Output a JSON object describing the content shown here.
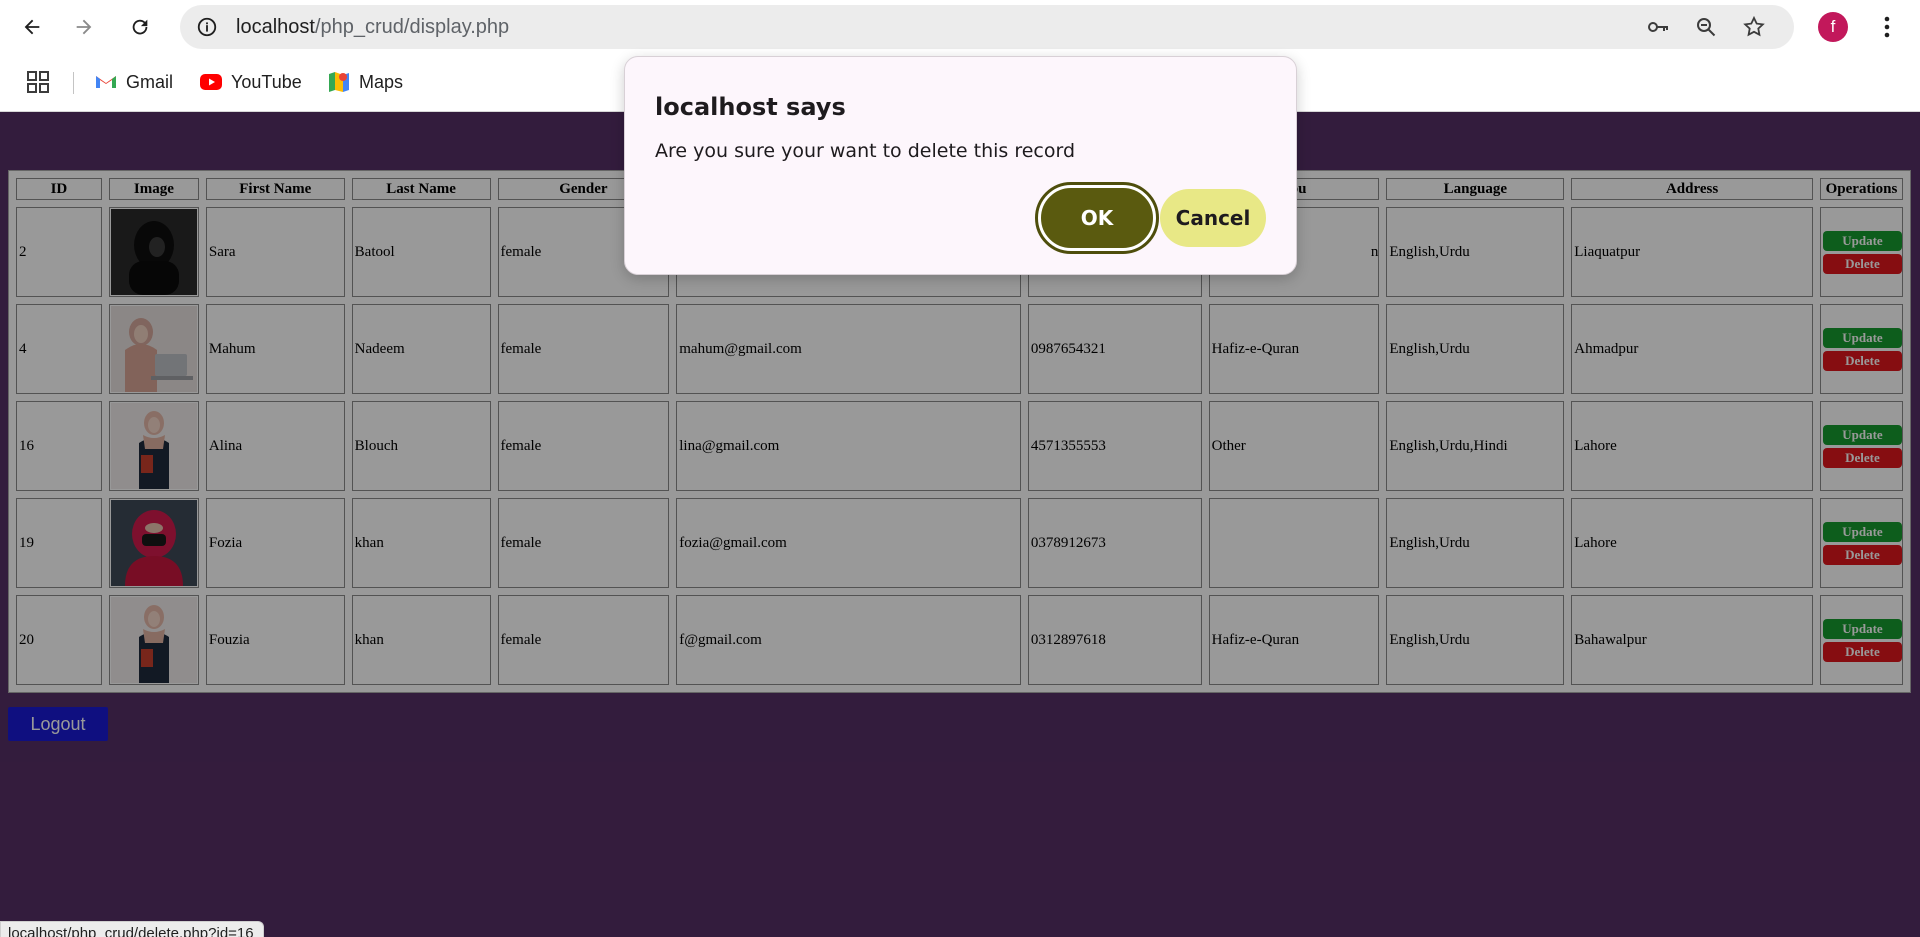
{
  "browser": {
    "url_host": "localhost",
    "url_path": "/php_crud/display.php",
    "avatar_letter": "f",
    "bookmarks": [
      {
        "label": "Gmail",
        "icon": "gmail-icon"
      },
      {
        "label": "YouTube",
        "icon": "youtube-icon"
      },
      {
        "label": "Maps",
        "icon": "maps-icon"
      }
    ]
  },
  "table": {
    "headers": [
      "ID",
      "Image",
      "First Name",
      "Last Name",
      "Gender",
      "",
      "",
      "You",
      "Language",
      "Address",
      "Operations"
    ],
    "rows": [
      {
        "id": "2",
        "first": "Sara",
        "last": "Batool",
        "gender": "female",
        "email": "",
        "phone": "",
        "you": "n",
        "language": "English,Urdu",
        "address": "Liaquatpur",
        "image": "black-hijab-portrait"
      },
      {
        "id": "4",
        "first": "Mahum",
        "last": "Nadeem",
        "gender": "female",
        "email": "mahum@gmail.com",
        "phone": "0987654321",
        "you": "Hafiz-e-Quran",
        "language": "English,Urdu",
        "address": "Ahmadpur",
        "image": "laptop-hijab-portrait"
      },
      {
        "id": "16",
        "first": "Alina",
        "last": "Blouch",
        "gender": "female",
        "email": "lina@gmail.com",
        "phone": "4571355553",
        "you": "Other",
        "language": "English,Urdu,Hindi",
        "address": "Lahore",
        "image": "standing-hijab-portrait"
      },
      {
        "id": "19",
        "first": "Fozia",
        "last": "khan",
        "gender": "female",
        "email": "fozia@gmail.com",
        "phone": "0378912673",
        "you": "",
        "language": "English,Urdu",
        "address": "Lahore",
        "image": "red-hijab-portrait"
      },
      {
        "id": "20",
        "first": "Fouzia",
        "last": "khan",
        "gender": "female",
        "email": "f@gmail.com",
        "phone": "0312897618",
        "you": "Hafiz-e-Quran",
        "language": "English,Urdu",
        "address": "Bahawalpur",
        "image": "standing-hijab-portrait"
      }
    ],
    "update_label": "Update",
    "delete_label": "Delete"
  },
  "logout_label": "Logout",
  "dialog": {
    "title": "localhost says",
    "message": "Are you sure your want to delete this record",
    "ok_label": "OK",
    "cancel_label": "Cancel"
  },
  "status_url": "localhost/php_crud/delete.php?id=16",
  "colors": {
    "page_bg": "#562f66",
    "update_btn": "#179b2f",
    "delete_btn": "#e0161d",
    "logout_btn": "#1a1ad6",
    "ok_btn": "#5a5a0f",
    "cancel_btn": "#e8e886"
  }
}
